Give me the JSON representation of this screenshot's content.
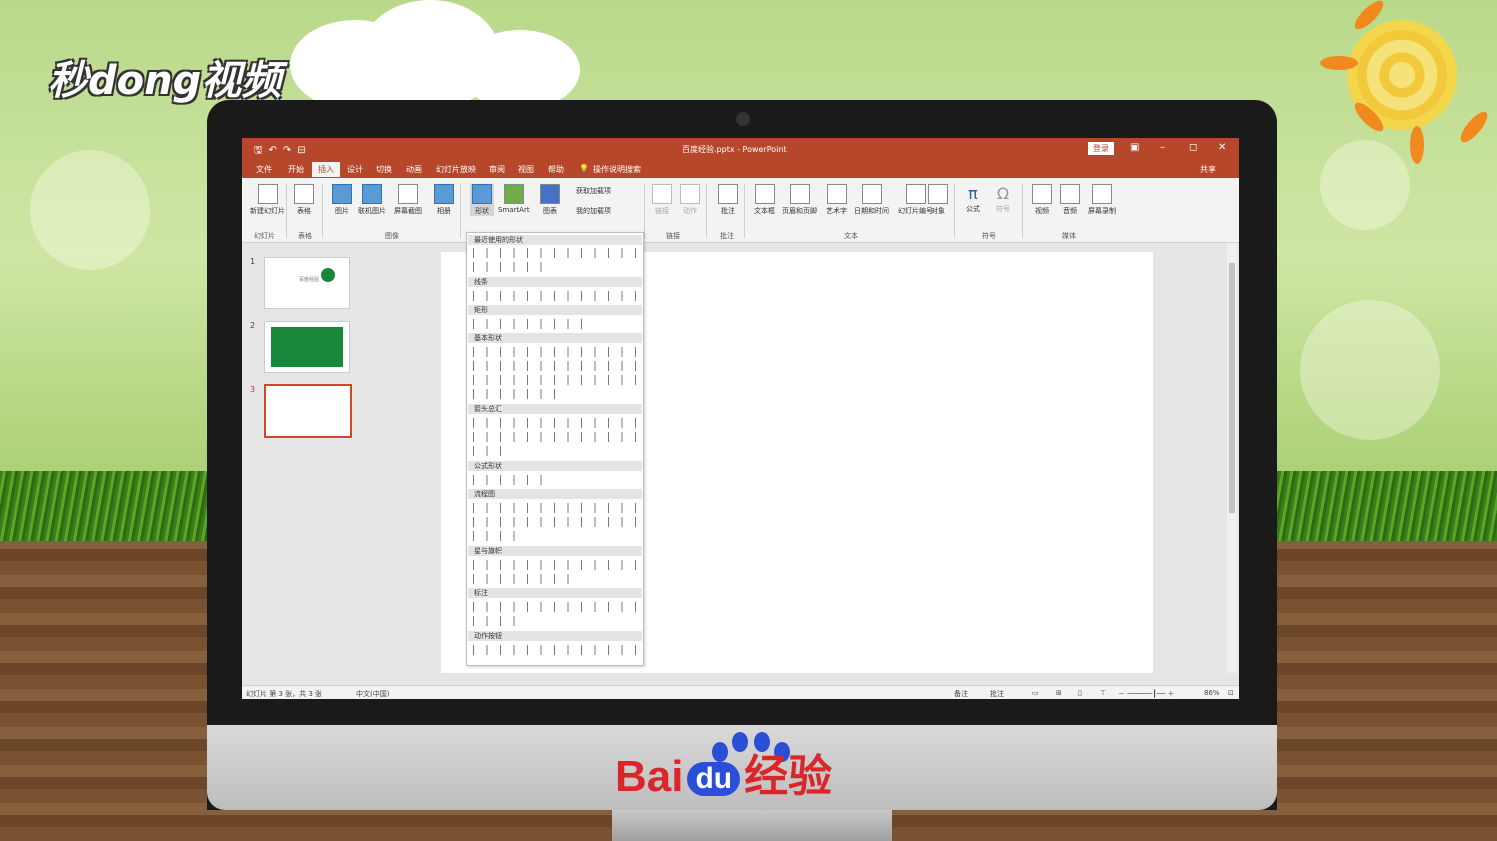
{
  "watermark": {
    "top_logo": "秒dong视频",
    "bottom_brand_left": "Bai",
    "bottom_brand_du": "du",
    "bottom_brand_right": "经验"
  },
  "window": {
    "title": "百度经验.pptx  -  PowerPoint",
    "login": "登录"
  },
  "menu": {
    "items": [
      "文件",
      "开始",
      "插入",
      "设计",
      "切换",
      "动画",
      "幻灯片放映",
      "审阅",
      "视图",
      "帮助"
    ],
    "active": "插入",
    "tellme": "操作说明搜索",
    "share": "共享"
  },
  "ribbon": {
    "buttons": [
      "新建幻灯片",
      "表格",
      "图片",
      "联机图片",
      "屏幕截图",
      "相册",
      "形状",
      "SmartArt",
      "图表",
      "获取加载项",
      "我的加载项",
      "链接",
      "动作",
      "批注",
      "文本框",
      "页眉和页脚",
      "艺术字",
      "日期和时间",
      "幻灯片编号",
      "对象",
      "公式",
      "符号",
      "视频",
      "音频",
      "屏幕录制"
    ],
    "groups": [
      "幻灯片",
      "表格",
      "图像",
      "链接",
      "批注",
      "文本",
      "符号",
      "媒体"
    ]
  },
  "shapes_dropdown": {
    "categories": [
      "最近使用的形状",
      "线条",
      "矩形",
      "基本形状",
      "箭头总汇",
      "公式形状",
      "流程图",
      "星与旗帜",
      "标注",
      "动作按钮"
    ]
  },
  "slides": {
    "numbers": [
      "1",
      "2",
      "3"
    ],
    "slide1_text": "百度经验"
  },
  "status": {
    "slide_info": "幻灯片 第 3 张，共 3 张",
    "language": "中文(中国)",
    "notes": "备注",
    "comments": "批注",
    "zoom": "86%"
  },
  "colors": {
    "accent": "#b7472a",
    "slide2_bg": "#17873a"
  }
}
